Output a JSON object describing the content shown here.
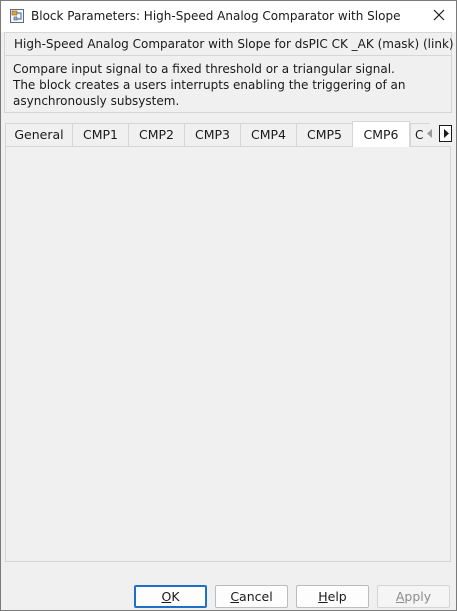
{
  "window": {
    "title": "Block Parameters: High-Speed Analog Comparator with Slope",
    "close_icon": "close-icon",
    "app_icon": "simulink-block-icon"
  },
  "group": {
    "title": "High-Speed Analog Comparator with Slope for dsPIC CK _AK (mask) (link)",
    "description_lines": [
      "Compare input signal to a fixed threshold or a triangular signal.",
      "The block creates a users interrupts enabling the triggering of an",
      "asynchronously subsystem."
    ]
  },
  "tabs": {
    "items": [
      {
        "label": "General"
      },
      {
        "label": "CMP1"
      },
      {
        "label": "CMP2"
      },
      {
        "label": "CMP3"
      },
      {
        "label": "CMP4"
      },
      {
        "label": "CMP5"
      },
      {
        "label": "CMP6"
      }
    ],
    "active_index": 6,
    "partial_label": "C",
    "scroll_left_icon": "chevron-left-icon",
    "scroll_right_icon": "chevron-right-icon"
  },
  "buttons": {
    "ok": {
      "prefix": "",
      "mnemonic": "O",
      "suffix": "K"
    },
    "cancel": {
      "prefix": "",
      "mnemonic": "C",
      "suffix": "ancel"
    },
    "help": {
      "prefix": "",
      "mnemonic": "H",
      "suffix": "elp"
    },
    "apply": {
      "prefix": "",
      "mnemonic": "A",
      "suffix": "pply",
      "enabled": false
    }
  },
  "colors": {
    "accent": "#1f6fc5",
    "disabled_text": "#8c8c8c"
  }
}
